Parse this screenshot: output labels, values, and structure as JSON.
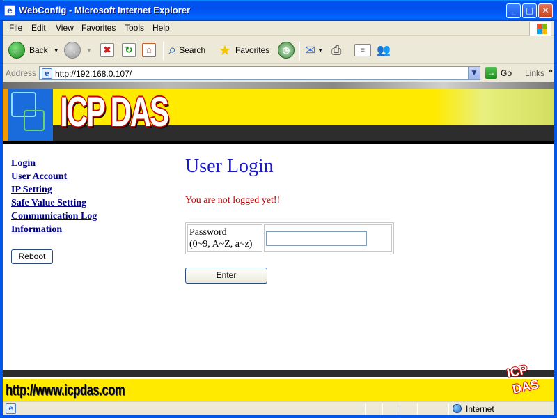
{
  "window": {
    "title": "WebConfig - Microsoft Internet Explorer",
    "title_icon": "e",
    "buttons": {
      "minimize": "_",
      "maximize": "□",
      "close": "✕"
    }
  },
  "menu": {
    "items": [
      {
        "label": "File"
      },
      {
        "label": "Edit"
      },
      {
        "label": "View"
      },
      {
        "label": "Favorites"
      },
      {
        "label": "Tools"
      },
      {
        "label": "Help"
      }
    ]
  },
  "toolbar": {
    "back_label": "Back",
    "search_label": "Search",
    "favorites_label": "Favorites"
  },
  "address": {
    "label": "Address",
    "url": "http://192.168.0.107/",
    "go_label": "Go",
    "links_label": "Links"
  },
  "banner": {
    "logo_text": "ICP DAS"
  },
  "nav": {
    "items": [
      {
        "label": "Login"
      },
      {
        "label": "User Account"
      },
      {
        "label": "IP Setting"
      },
      {
        "label": "Safe Value Setting"
      },
      {
        "label": "Communication Log"
      },
      {
        "label": "Information"
      }
    ],
    "reboot_label": "Reboot"
  },
  "main": {
    "title": "User Login",
    "error": "You are not logged yet!!",
    "password_label": "Password",
    "password_hint": "(0~9, A~Z, a~z)",
    "password_value": "",
    "enter_label": "Enter"
  },
  "footer": {
    "url": "http://www.icpdas.com",
    "logo_line1": "ICP",
    "logo_line2": "DAS"
  },
  "status": {
    "zone": "Internet"
  },
  "colors": {
    "banner_yellow": "#ffea00",
    "nav_link": "#00008b",
    "title_blue": "#1a1acc",
    "error_red": "#b30000"
  }
}
